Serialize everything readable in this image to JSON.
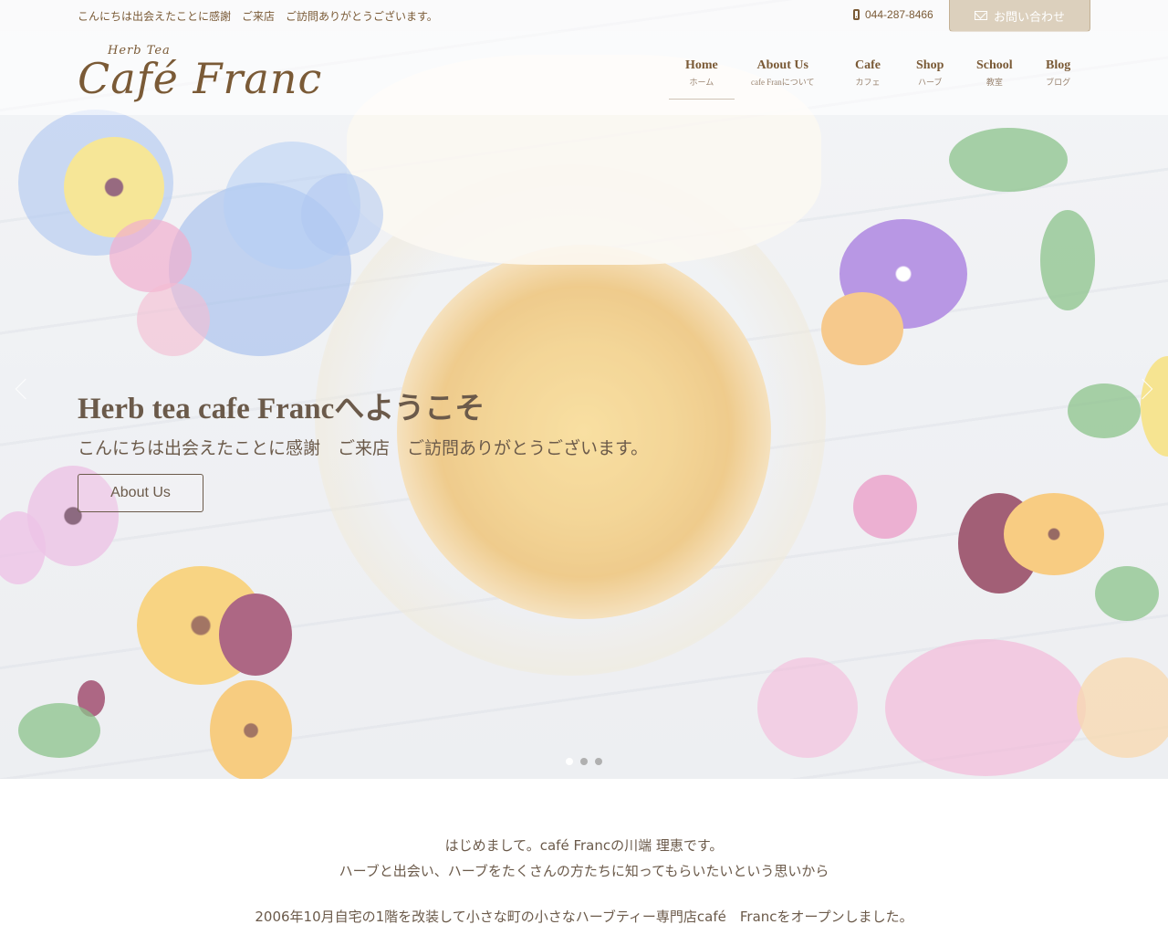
{
  "topbar": {
    "tagline": "こんにちは出会えたことに感謝　ご来店　ご訪問ありがとうございます。",
    "phone": "044-287-8466",
    "contact_label": "お問い合わせ"
  },
  "logo": {
    "small": "Herb  Tea",
    "main": "Café Franc"
  },
  "nav": [
    {
      "label": "Home",
      "sub": "ホーム"
    },
    {
      "label": "About Us",
      "sub": "cafe Franについて"
    },
    {
      "label": "Cafe",
      "sub": "カフェ"
    },
    {
      "label": "Shop",
      "sub": "ハーブ"
    },
    {
      "label": "School",
      "sub": "教室"
    },
    {
      "label": "Blog",
      "sub": "ブログ"
    }
  ],
  "hero": {
    "title": "Herb tea cafe Francへようこそ",
    "subtitle": "こんにちは出会えたことに感謝　ご来店　ご訪問ありがとうございます。",
    "button": "About Us",
    "slide_count": 3,
    "active_slide": 1
  },
  "intro": {
    "line1": "はじめまして。café Francの川端 理恵です。",
    "line2": "ハーブと出会い、ハーブをたくさんの方たちに知ってもらいたいという思いから",
    "line3": "2006年10月自宅の1階を改装して小さな町の小さなハーブティー専門店café　Francをオープンしました。"
  },
  "colors": {
    "brand_brown": "#7a5a36",
    "text": "#6b5a4a",
    "contact_bg": "#d6c8b2"
  }
}
